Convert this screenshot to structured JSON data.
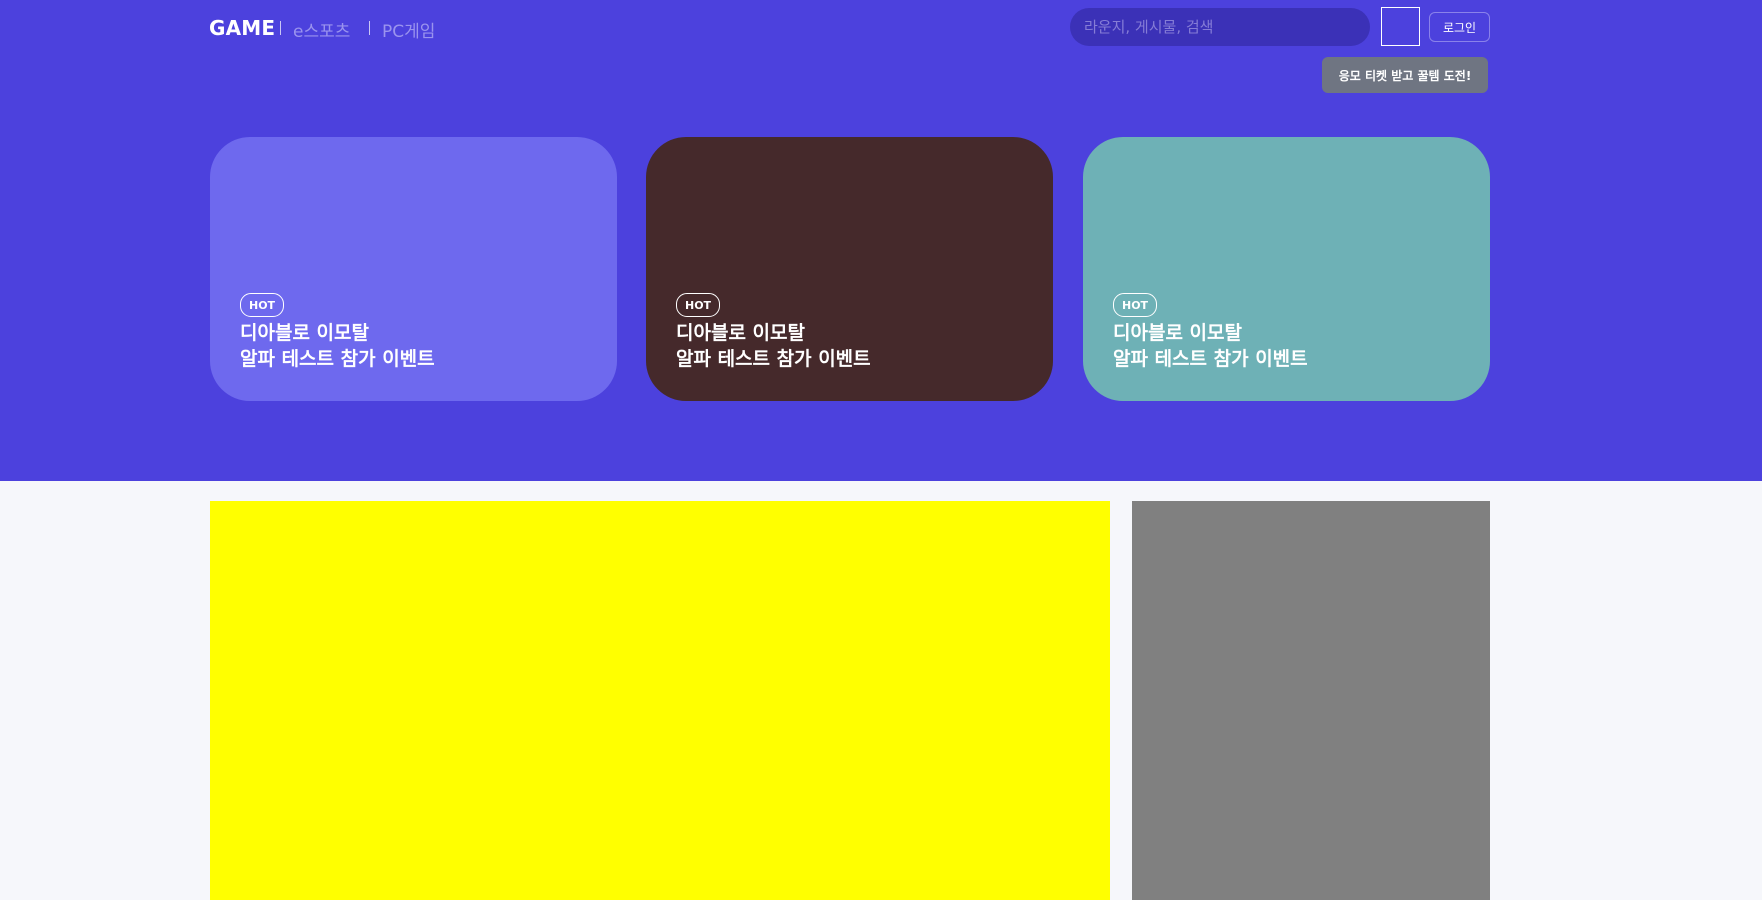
{
  "header": {
    "logo": "GAME",
    "nav": [
      "e스포츠",
      "PC게임"
    ],
    "search_placeholder": "라운지, 게시물, 검색",
    "login_label": "로그인",
    "tooltip": "응모 티켓 받고 꿀템 도전!"
  },
  "cards": [
    {
      "badge": "HOT",
      "title_line1": "디아블로 이모탈",
      "title_line2": "알파 테스트 참가 이벤트",
      "color": "#6e69ee"
    },
    {
      "badge": "HOT",
      "title_line1": "디아블로 이모탈",
      "title_line2": "알파 테스트 참가 이벤트",
      "color": "#45292b"
    },
    {
      "badge": "HOT",
      "title_line1": "디아블로 이모탈",
      "title_line2": "알파 테스트 참가 이벤트",
      "color": "#6eb1b6"
    }
  ],
  "colors": {
    "hero_bg": "#4c41dd",
    "page_bg": "#f6f7fb",
    "ad_left": "#ffff00",
    "ad_right": "#808080"
  }
}
